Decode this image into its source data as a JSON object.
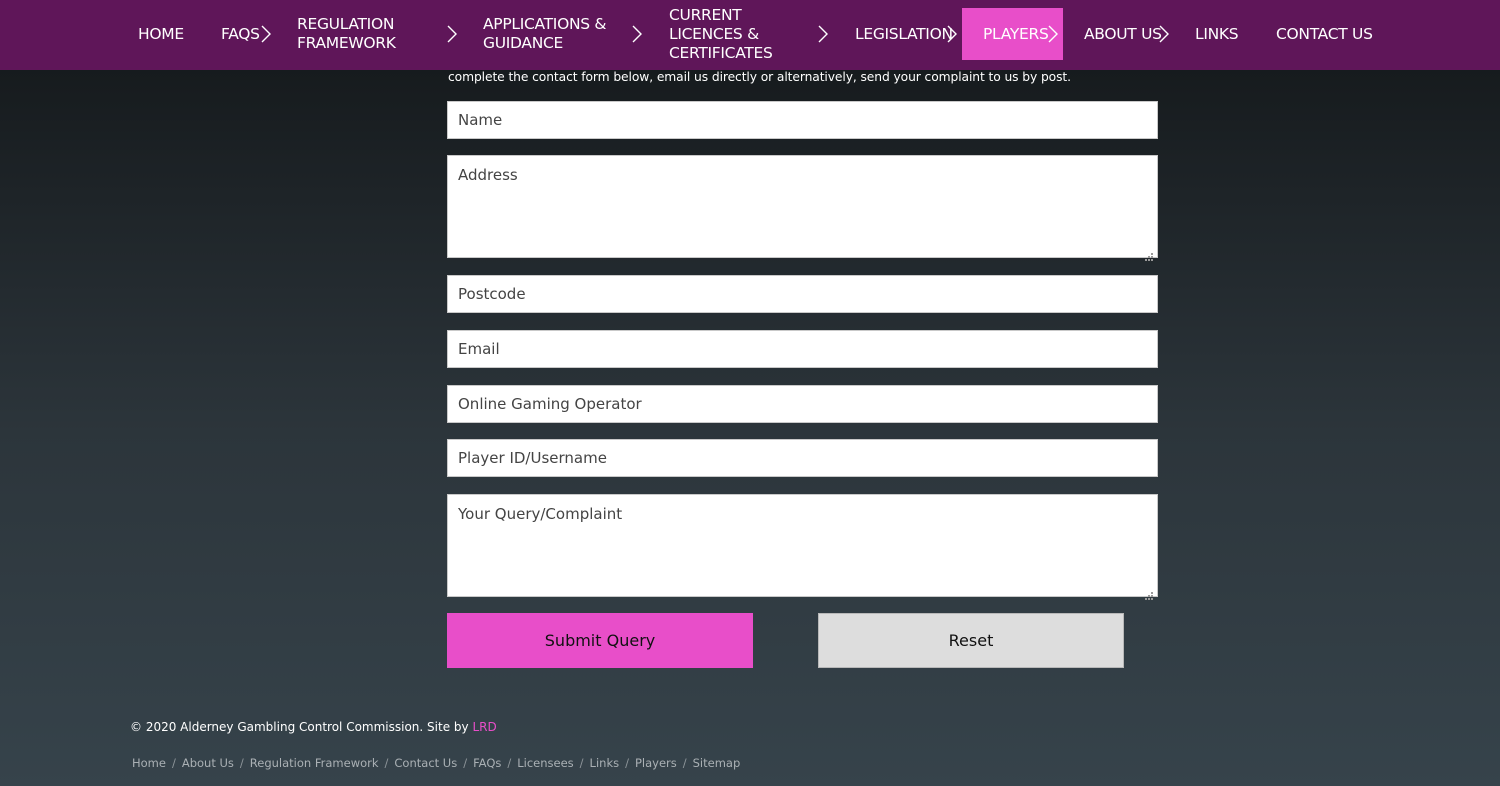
{
  "nav": {
    "items": [
      {
        "label": "HOME",
        "has_submenu": false,
        "active": false
      },
      {
        "label": "FAQS",
        "has_submenu": true,
        "active": false
      },
      {
        "label": "REGULATION FRAMEWORK",
        "has_submenu": true,
        "active": false
      },
      {
        "label": "APPLICATIONS & GUIDANCE",
        "has_submenu": true,
        "active": false
      },
      {
        "label": "CURRENT LICENCES & CERTIFICATES",
        "has_submenu": true,
        "active": false
      },
      {
        "label": "LEGISLATION",
        "has_submenu": true,
        "active": false
      },
      {
        "label": "PLAYERS",
        "has_submenu": true,
        "active": true
      },
      {
        "label": "ABOUT US",
        "has_submenu": true,
        "active": false
      },
      {
        "label": "LINKS",
        "has_submenu": false,
        "active": false
      },
      {
        "label": "CONTACT US",
        "has_submenu": false,
        "active": false
      }
    ]
  },
  "intro": {
    "text": "complete the contact form below, email us directly or alternatively, send your complaint to us by post."
  },
  "form": {
    "name_placeholder": "Name",
    "address_placeholder": "Address",
    "postcode_placeholder": "Postcode",
    "email_placeholder": "Email",
    "operator_placeholder": "Online Gaming Operator",
    "player_id_placeholder": "Player ID/Username",
    "query_placeholder": "Your Query/Complaint",
    "submit_label": "Submit Query",
    "reset_label": "Reset"
  },
  "footer": {
    "copyright": "© 2020 Alderney Gambling Control Commission. Site by",
    "credit": "LRD",
    "links": [
      "Home",
      "About Us",
      "Regulation Framework",
      "Contact Us",
      "FAQs",
      "Licensees",
      "Links",
      "Players",
      "Sitemap"
    ],
    "separator": "/"
  },
  "colors": {
    "nav_bg": "#5f1659",
    "accent": "#e84ec9",
    "reset_bg": "#dddddd"
  }
}
